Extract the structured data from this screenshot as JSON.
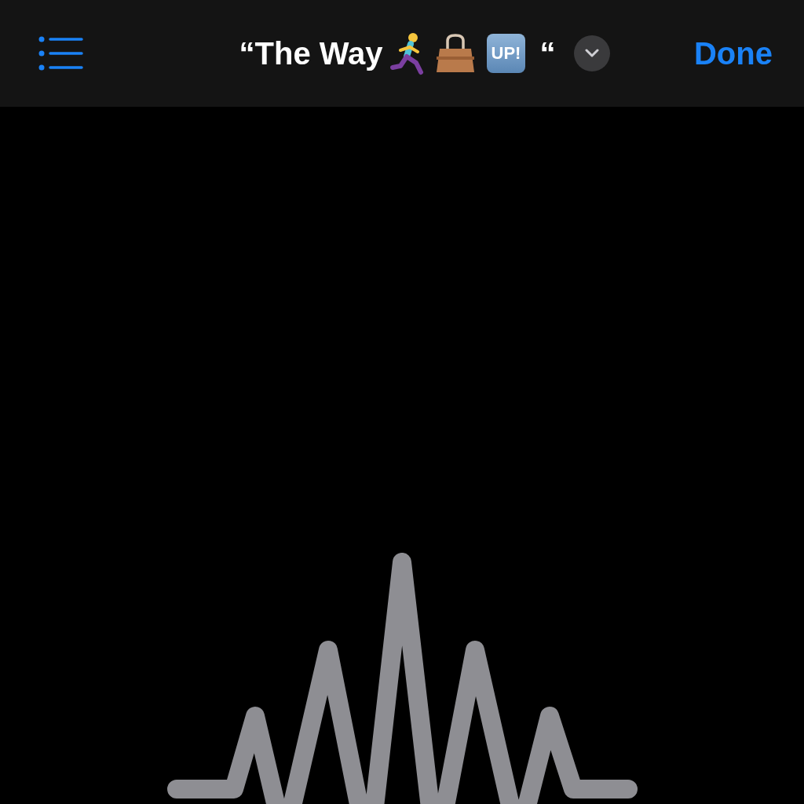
{
  "header": {
    "title": "“The Way",
    "badge": "UP!",
    "title_end": "“",
    "done_label": "Done"
  }
}
